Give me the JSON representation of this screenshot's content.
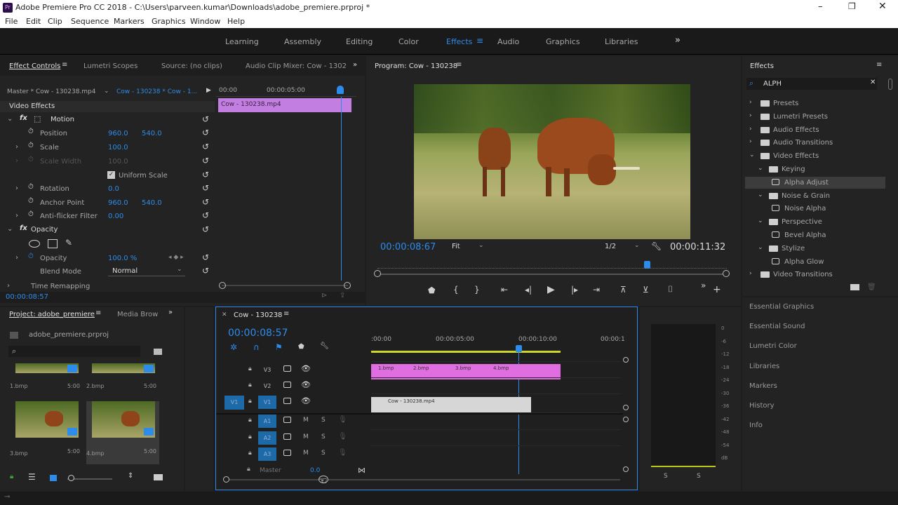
{
  "titlebar": {
    "title": "Adobe Premiere Pro CC 2018 - C:\\Users\\parveen.kumar\\Downloads\\adobe_premiere.prproj *"
  },
  "menu": [
    "File",
    "Edit",
    "Clip",
    "Sequence",
    "Markers",
    "Graphics",
    "Window",
    "Help"
  ],
  "workspaces": [
    "Learning",
    "Assembly",
    "Editing",
    "Color",
    "Effects",
    "Audio",
    "Graphics",
    "Libraries"
  ],
  "effect_controls": {
    "tabs": [
      "Effect Controls",
      "Lumetri Scopes",
      "Source: (no clips)",
      "Audio Clip Mixer: Cow - 1302"
    ],
    "master": "Master * Cow - 130238.mp4",
    "sequence": "Cow - 130238 * Cow - 1...",
    "ruler": [
      "00:00",
      "00:00:05:00"
    ],
    "clip": "Cow - 130238.mp4",
    "video_effects": "Video Effects",
    "motion": "Motion",
    "position": {
      "label": "Position",
      "x": "960.0",
      "y": "540.0"
    },
    "scale": {
      "label": "Scale",
      "v": "100.0"
    },
    "scale_width": {
      "label": "Scale Width",
      "v": "100.0"
    },
    "uniform": "Uniform Scale",
    "rotation": {
      "label": "Rotation",
      "v": "0.0"
    },
    "anchor": {
      "label": "Anchor Point",
      "x": "960.0",
      "y": "540.0"
    },
    "antiflicker": {
      "label": "Anti-flicker Filter",
      "v": "0.00"
    },
    "opacity_group": "Opacity",
    "opacity": {
      "label": "Opacity",
      "v": "100.0 %"
    },
    "blend": {
      "label": "Blend Mode",
      "v": "Normal"
    },
    "time_remap": "Time Remapping",
    "timecode": "00:00:08:57"
  },
  "program": {
    "title": "Program: Cow - 130238",
    "timecode": "00:00:08:67",
    "fit": "Fit",
    "quality": "1/2",
    "duration": "00:00:11:32"
  },
  "effects": {
    "title": "Effects",
    "search": "ALPH",
    "tree": [
      {
        "label": "Presets",
        "level": 0
      },
      {
        "label": "Lumetri Presets",
        "level": 0
      },
      {
        "label": "Audio Effects",
        "level": 0
      },
      {
        "label": "Audio Transitions",
        "level": 0
      },
      {
        "label": "Video Effects",
        "level": 0
      },
      {
        "label": "Keying",
        "level": 1
      },
      {
        "label": "Alpha Adjust",
        "level": 2
      },
      {
        "label": "Noise & Grain",
        "level": 1
      },
      {
        "label": "Noise Alpha",
        "level": 2
      },
      {
        "label": "Perspective",
        "level": 1
      },
      {
        "label": "Bevel Alpha",
        "level": 2
      },
      {
        "label": "Stylize",
        "level": 1
      },
      {
        "label": "Alpha Glow",
        "level": 2
      },
      {
        "label": "Video Transitions",
        "level": 0
      }
    ],
    "panels": [
      "Essential Graphics",
      "Essential Sound",
      "Lumetri Color",
      "Libraries",
      "Markers",
      "History",
      "Info"
    ]
  },
  "project": {
    "tabs": [
      "Project: adobe_premiere",
      "Media Brow"
    ],
    "file": "adobe_premiere.prproj",
    "items": [
      {
        "name": "1.bmp",
        "dur": "5:00"
      },
      {
        "name": "2.bmp",
        "dur": "5:00"
      },
      {
        "name": "3.bmp",
        "dur": "5:00"
      },
      {
        "name": "4.bmp",
        "dur": "5:00"
      }
    ]
  },
  "timeline": {
    "title": "Cow - 130238",
    "timecode": "00:00:08:57",
    "ruler": [
      ":00:00",
      "00:00:05:00",
      "00:00:10:00",
      "00:00:1"
    ],
    "tracks": [
      "V3",
      "V2",
      "V1",
      "A1",
      "A2",
      "A3"
    ],
    "source_track": "V1",
    "master": "Master",
    "master_val": "0.0",
    "mute": "M",
    "solo": "S",
    "clips": [
      "1.bmp",
      "2.bmp",
      "3.bmp",
      "4.bmp"
    ],
    "video_clip": "Cow - 130238.mp4"
  },
  "meters": {
    "scale": [
      "0",
      "-6",
      "-12",
      "-18",
      "-24",
      "-30",
      "-36",
      "-42",
      "-48",
      "-54",
      "dB"
    ],
    "solo": "S"
  }
}
